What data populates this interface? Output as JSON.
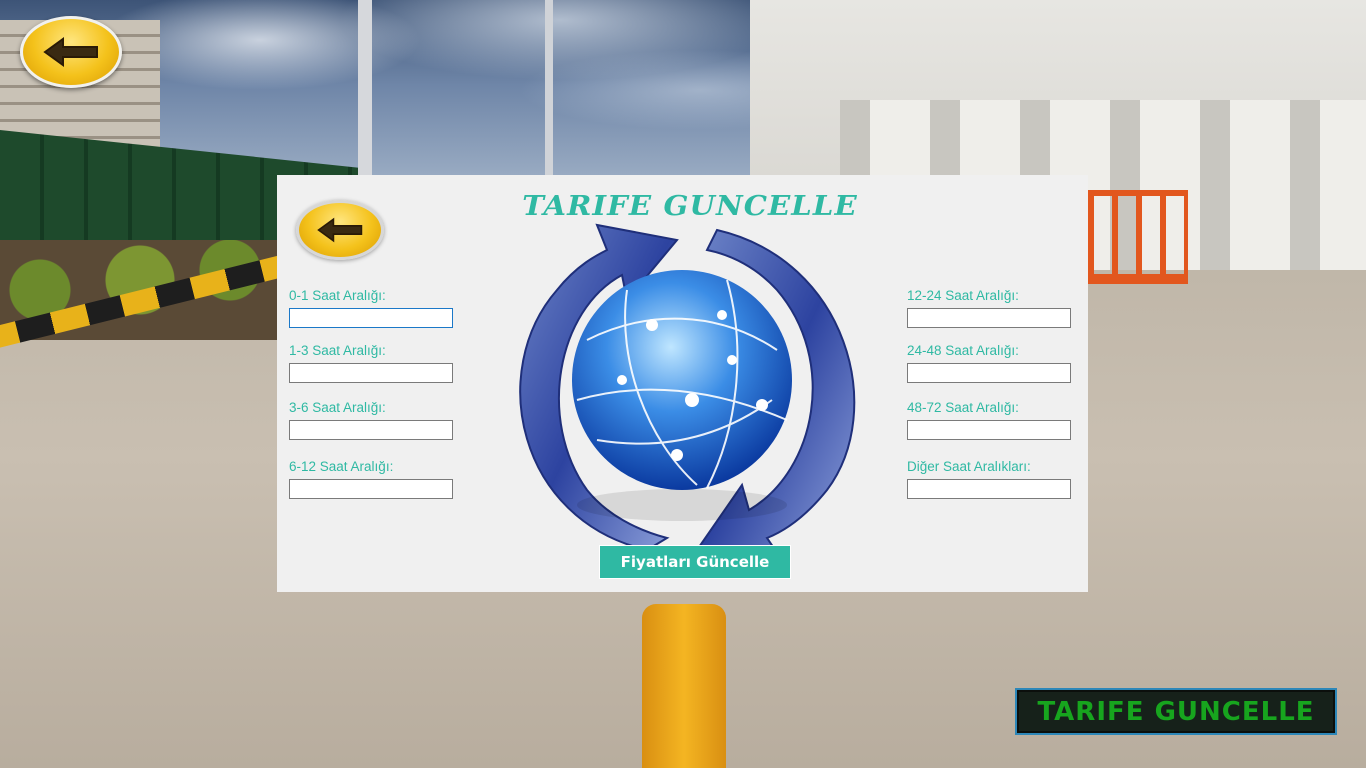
{
  "window": {
    "title": "TARIFE GUNCELLE"
  },
  "icons": {
    "back": "arrow-left-icon",
    "refresh": "refresh-globe-icon"
  },
  "colors": {
    "accent": "#2fb9a3",
    "label_text": "#2fb9a3",
    "corner_label_text": "#17a51e",
    "back_button": "#f4c21b"
  },
  "dialog": {
    "title": "TARIFE GUNCELLE",
    "fields_left": [
      {
        "label": "0-1 Saat Aralığı:",
        "value": ""
      },
      {
        "label": "1-3 Saat Aralığı:",
        "value": ""
      },
      {
        "label": "3-6 Saat Aralığı:",
        "value": ""
      },
      {
        "label": "6-12 Saat Aralığı:",
        "value": ""
      }
    ],
    "fields_right": [
      {
        "label": "12-24 Saat Aralığı:",
        "value": ""
      },
      {
        "label": "24-48 Saat Aralığı:",
        "value": ""
      },
      {
        "label": "48-72 Saat Aralığı:",
        "value": ""
      },
      {
        "label": "Diğer Saat Aralıkları:",
        "value": ""
      }
    ],
    "update_button": "Fiyatları Güncelle"
  },
  "corner_label": "TARIFE GUNCELLE"
}
